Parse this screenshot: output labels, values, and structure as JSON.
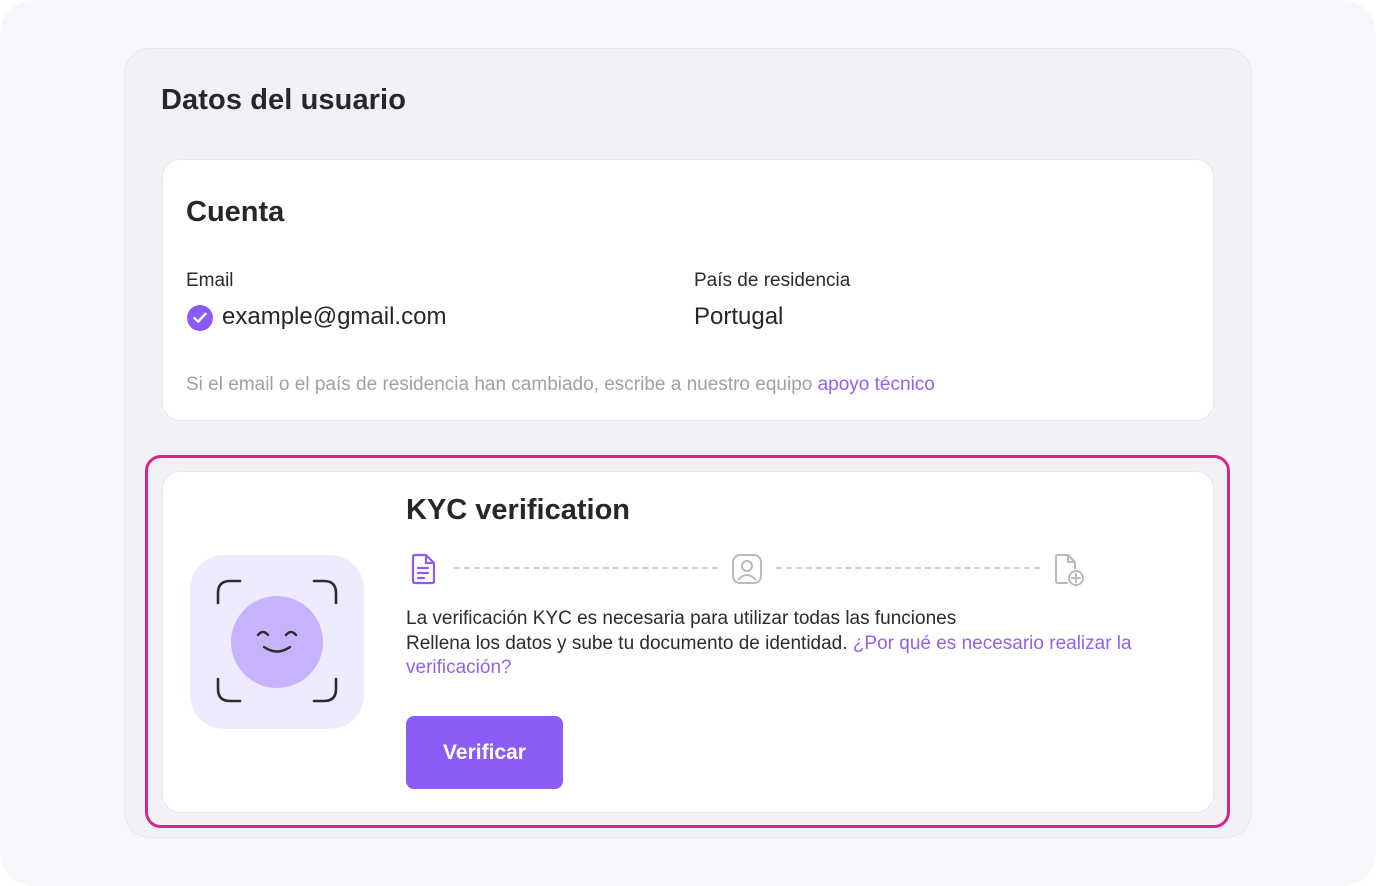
{
  "panel": {
    "title": "Datos del usuario"
  },
  "account": {
    "title": "Cuenta",
    "email_label": "Email",
    "email_value": "example@gmail.com",
    "email_verified_icon": "check-circle-icon",
    "country_label": "País de residencia",
    "country_value": "Portugal",
    "note_text": "Si el email o el país de residencia han cambiado, escribe a nuestro equipo ",
    "note_link": "apoyo técnico"
  },
  "kyc": {
    "title": "KYC verification",
    "steps": [
      "document-icon",
      "user-portrait-icon",
      "file-add-icon"
    ],
    "line1": "La verificación KYC es necesaria para utilizar todas las funciones",
    "line2": "Rellena los datos y sube tu documento de identidad. ",
    "link": "¿Por qué es necesario realizar la verificación?",
    "button_label": "Verificar"
  },
  "colors": {
    "accent": "#8b5cf6",
    "highlight": "#d8258a",
    "link": "#8f62f7"
  }
}
